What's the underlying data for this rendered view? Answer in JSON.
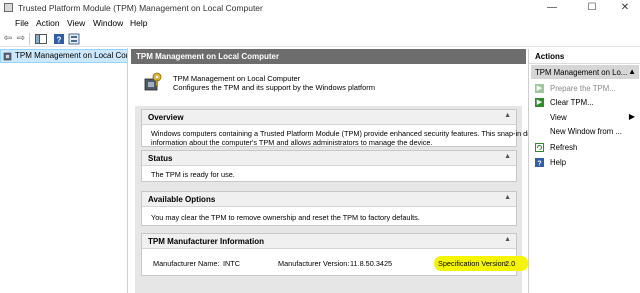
{
  "window": {
    "title": "Trusted Platform Module (TPM) Management on Local Computer",
    "minimize_glyph": "—",
    "maximize_glyph": "☐",
    "close_glyph": "✕"
  },
  "menu": [
    "File",
    "Action",
    "View",
    "Window",
    "Help"
  ],
  "toolbar": {
    "back_glyph": "⇦",
    "forward_glyph": "⇨"
  },
  "tree": {
    "selected_label": "TPM Management on Local Comp"
  },
  "main": {
    "header": "TPM Management on Local Computer",
    "intro_title": "TPM Management on Local Computer",
    "intro_desc": "Configures the TPM and its support by the Windows platform",
    "sections": {
      "overview": {
        "title": "Overview",
        "line1": "Windows computers containing a Trusted Platform Module (TPM) provide enhanced security features. This snap-in displays",
        "line2": "information about the computer's TPM and allows administrators to manage the device."
      },
      "status": {
        "title": "Status",
        "text": "The TPM is ready for use."
      },
      "options": {
        "title": "Available Options",
        "text": "You may clear the TPM to remove ownership and reset the TPM to factory defaults."
      },
      "manufacturer": {
        "title": "TPM Manufacturer Information",
        "name_label": "Manufacturer Name:",
        "name_value": "INTC",
        "version_label": "Manufacturer Version:",
        "version_value": "11.8.50.3425",
        "spec_label": "Specification Version:",
        "spec_value": "2.0"
      }
    },
    "collapse_glyph": "▲"
  },
  "actions": {
    "header": "Actions",
    "sub_header": "TPM Management on Lo...",
    "sub_arrow": "▲",
    "items": [
      {
        "label": "Prepare the TPM...",
        "icon": "prepare-icon",
        "enabled": false
      },
      {
        "label": "Clear TPM...",
        "icon": "clear-icon",
        "enabled": true
      },
      {
        "label": "View",
        "icon": "none",
        "submenu_glyph": "▶"
      },
      {
        "label": "New Window from ...",
        "icon": "none"
      },
      {
        "label": "Refresh",
        "icon": "refresh-icon"
      },
      {
        "label": "Help",
        "icon": "help-icon"
      }
    ]
  },
  "colors": {
    "header_bg": "#6d6d6d",
    "selection_bg": "#cce8ff",
    "highlight": "#f5f500",
    "action_green": "#2e8b2e"
  }
}
